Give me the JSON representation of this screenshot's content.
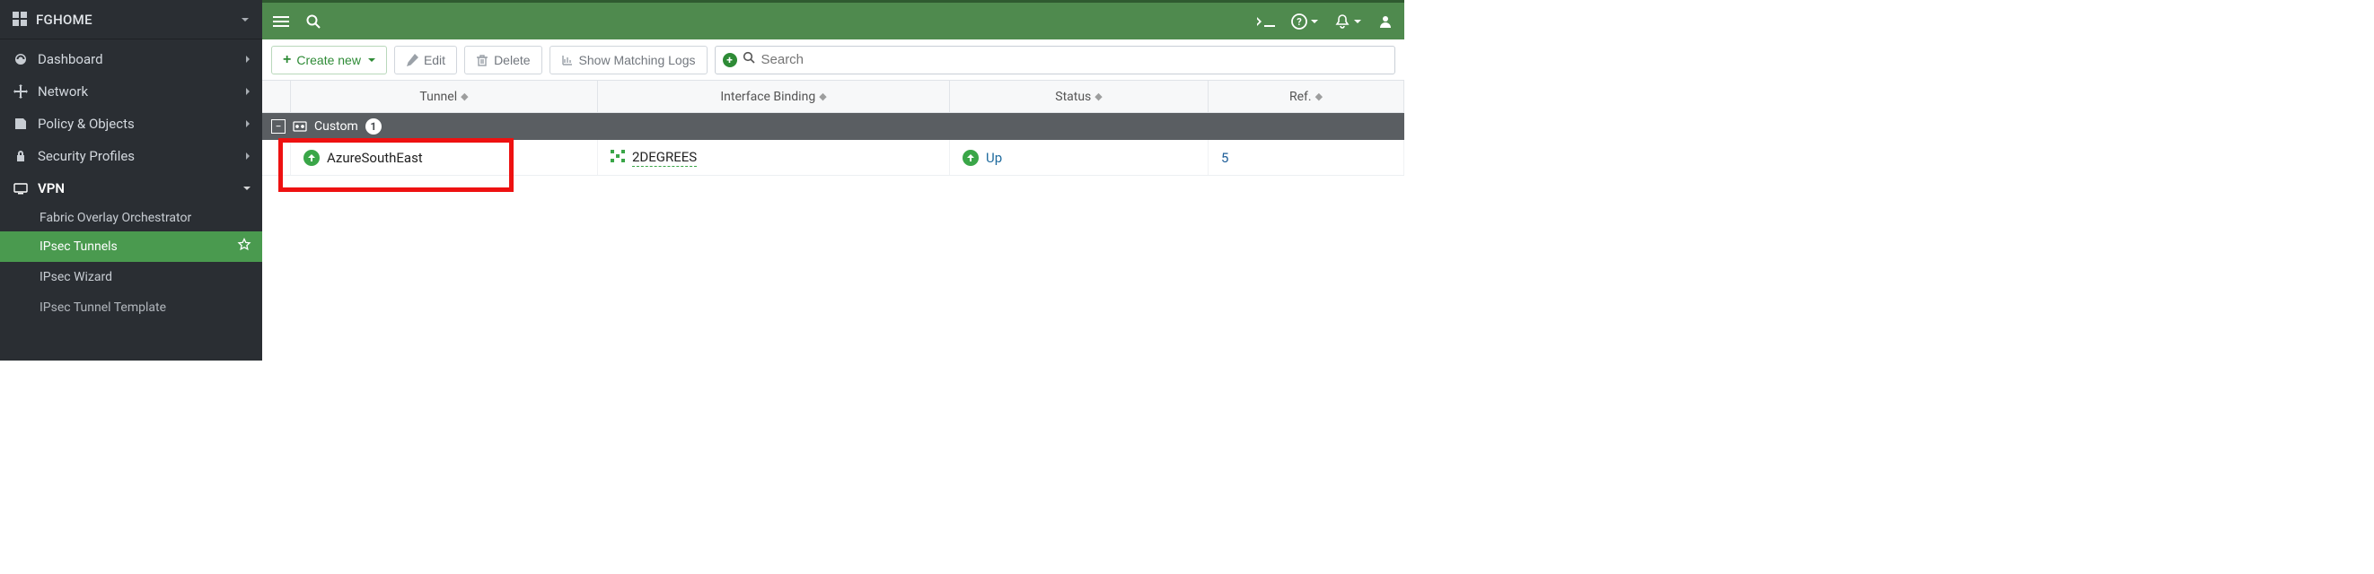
{
  "sidebar": {
    "brand": "FGHOME",
    "items": [
      {
        "label": "Dashboard"
      },
      {
        "label": "Network"
      },
      {
        "label": "Policy & Objects"
      },
      {
        "label": "Security Profiles"
      },
      {
        "label": "VPN"
      }
    ],
    "vpn_sub": [
      {
        "label": "Fabric Overlay Orchestrator"
      },
      {
        "label": "IPsec Tunnels"
      },
      {
        "label": "IPsec Wizard"
      },
      {
        "label": "IPsec Tunnel Template"
      }
    ]
  },
  "toolbar": {
    "create_label": "Create new",
    "edit_label": "Edit",
    "delete_label": "Delete",
    "logs_label": "Show Matching Logs",
    "search_placeholder": "Search"
  },
  "table": {
    "headers": {
      "tunnel": "Tunnel",
      "iface": "Interface Binding",
      "status": "Status",
      "ref": "Ref."
    },
    "group_label": "Custom",
    "group_count": "1",
    "rows": [
      {
        "tunnel": "AzureSouthEast",
        "iface": "2DEGREES",
        "status": "Up",
        "ref": "5"
      }
    ]
  },
  "colors": {
    "green": "#4f8a4e",
    "sidebar": "#2a2e33",
    "link": "#1f5f99",
    "highlight": "#e11"
  }
}
